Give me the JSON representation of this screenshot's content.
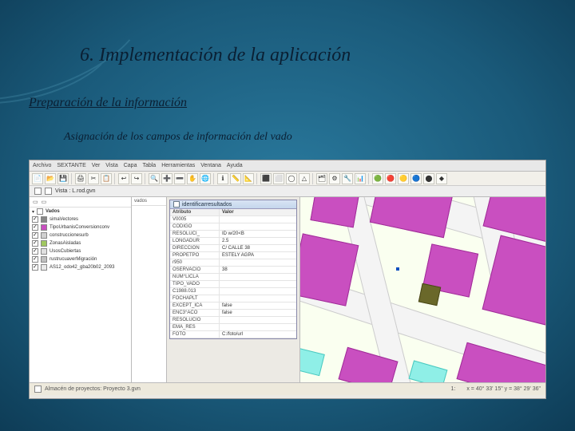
{
  "slide": {
    "title": "6. Implementación de la aplicación",
    "section": "Preparación de la información",
    "subtitle": "Asignación de los campos de información del vado"
  },
  "menubar": [
    "Archivo",
    "SEXTANTE",
    "Ver",
    "Vista",
    "Capa",
    "Tabla",
    "Herramientas",
    "Ventana",
    "Ayuda"
  ],
  "doctab": {
    "label": "Vista : L.rod.gvn"
  },
  "toc": {
    "tabs": [
      "..",
      ".."
    ],
    "root": "Vados",
    "items": [
      {
        "label": "simaVectores",
        "swatch": "#888"
      },
      {
        "label": "TipoUrbanisConversionconv",
        "swatch": "#c94fc0"
      },
      {
        "label": "construccionesurb",
        "swatch": "#d0d0d0"
      },
      {
        "label": "ZonasAisladas",
        "swatch": "#a0c860"
      },
      {
        "label": "UsosCubiertas",
        "swatch": "#e0e0e0"
      },
      {
        "label": "rustrucuaverMigración",
        "swatch": "#c0c0c0"
      },
      {
        "label": "AS12_odo42_gba20b02_2093",
        "swatch": "#e8e8e8"
      }
    ]
  },
  "mid": {
    "label": "vados"
  },
  "results": {
    "title": "identificarresultados",
    "headers": [
      "Atributo",
      "Valor"
    ],
    "rows": [
      [
        "V0005",
        ""
      ],
      [
        "CODIGO",
        ""
      ],
      [
        "RESOLUCI_",
        "ID w/20<B"
      ],
      [
        "LONGADUR",
        "2.5"
      ],
      [
        "DIRECCION",
        "C/ CALLE 38"
      ],
      [
        "PROPETPO",
        "ESTELY AGPA"
      ],
      [
        "r950",
        ""
      ],
      [
        "OSERVACIO",
        "38"
      ],
      [
        "NUM°LICLA",
        ""
      ],
      [
        "TIPO_VADO",
        ""
      ],
      [
        "C1988.013",
        ""
      ],
      [
        "FOCHAPLT",
        ""
      ],
      [
        "EXCEPT_ICA",
        "false"
      ],
      [
        "ENC3°ACO",
        "false"
      ],
      [
        "RESOLUCIO",
        ""
      ],
      [
        "EMA_RES",
        ""
      ],
      [
        "FOTO",
        "C:/foto/url"
      ]
    ]
  },
  "statusbar": {
    "project": "Almacén de proyectos: Proyecto 3.gvn",
    "scale": "1:",
    "coords": "x = 40° 33' 15\"   y = 38° 29' 36\""
  },
  "icons": {
    "toolbar_count": 32
  }
}
